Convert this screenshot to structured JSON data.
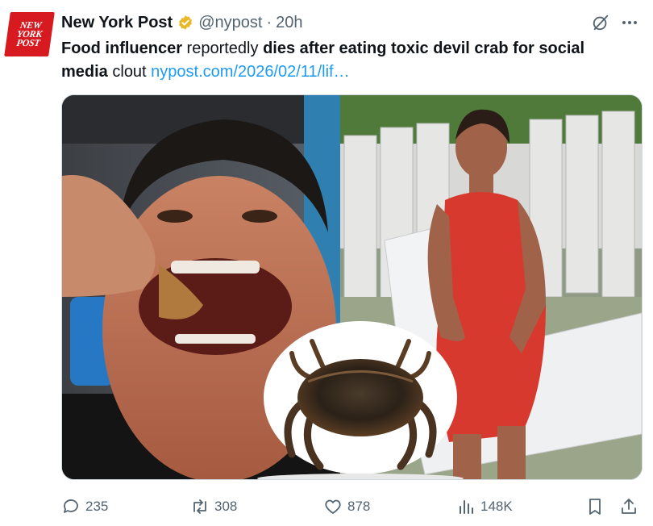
{
  "account": {
    "logo_lines": [
      "NEW",
      "YORK",
      "POST"
    ],
    "name": "New York Post",
    "handle": "@nypost",
    "separator": "·",
    "time": "20h"
  },
  "tweet": {
    "seg1": "Food influencer",
    "seg2": " reportedly ",
    "seg3": "dies after eating toxic devil crab for social media",
    "seg4": " clout ",
    "link": "nypost.com/2026/02/11/lif…"
  },
  "actions": {
    "replies": "235",
    "reposts": "308",
    "likes": "878",
    "views": "148K"
  },
  "colors": {
    "brand_red": "#d71920",
    "verified_gold": "#e8b829",
    "link_blue": "#1d9bf0",
    "muted": "#536471"
  },
  "icons": [
    "grok-icon",
    "more-icon",
    "reply-icon",
    "repost-icon",
    "like-icon",
    "views-icon",
    "bookmark-icon",
    "share-icon",
    "verified-icon"
  ]
}
